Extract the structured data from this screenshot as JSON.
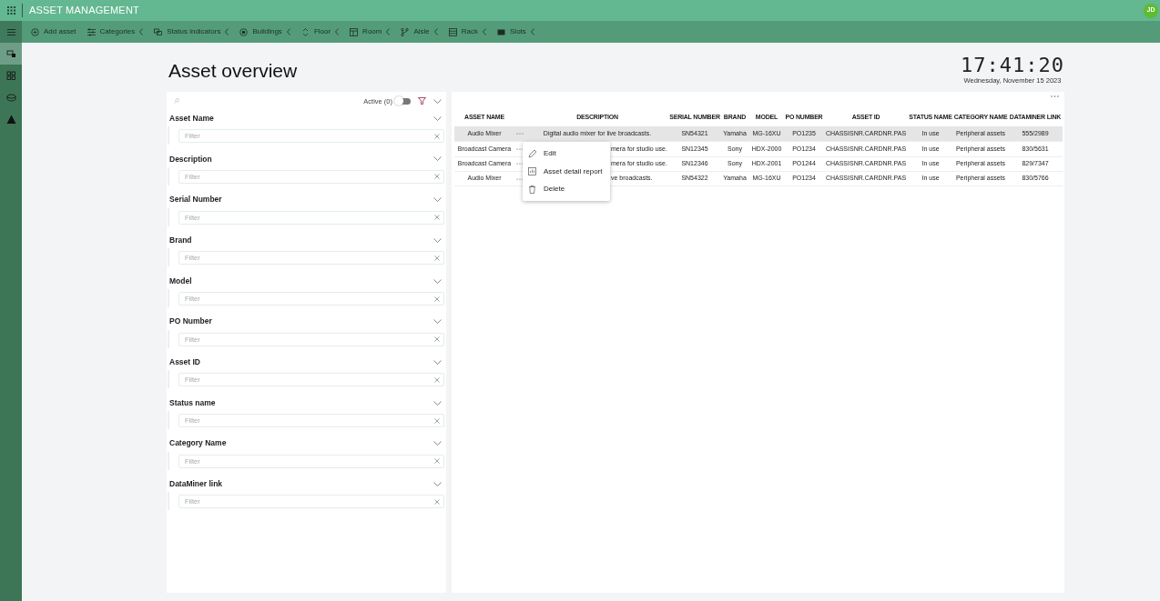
{
  "app": {
    "title": "ASSET MANAGEMENT",
    "user_initials": "JD"
  },
  "toolbar": [
    {
      "label": "Add asset",
      "kind": "add",
      "chevron": false
    },
    {
      "label": "Categories",
      "kind": "categories",
      "chevron": true
    },
    {
      "label": "Status indicators",
      "kind": "status",
      "chevron": true
    },
    {
      "label": "Buildings",
      "kind": "buildings",
      "chevron": true
    },
    {
      "label": "Floor",
      "kind": "floor",
      "chevron": true
    },
    {
      "label": "Room",
      "kind": "room",
      "chevron": true
    },
    {
      "label": "Aisle",
      "kind": "aisle",
      "chevron": true
    },
    {
      "label": "Rack",
      "kind": "rack",
      "chevron": true
    },
    {
      "label": "Slots",
      "kind": "slots",
      "chevron": true
    }
  ],
  "sidebar": {
    "items": [
      {
        "kind": "assets",
        "selected": true
      },
      {
        "kind": "grid",
        "selected": false
      },
      {
        "kind": "disk",
        "selected": false
      },
      {
        "kind": "warning",
        "selected": false
      }
    ]
  },
  "page_title": "Asset overview",
  "clock": {
    "time": "17:41:20",
    "date": "Wednesday, November 15 2023"
  },
  "filters": {
    "active_label": "Active (0)",
    "active_on": false,
    "fields": [
      {
        "label": "Asset Name",
        "placeholder": "Filter"
      },
      {
        "label": "Description",
        "placeholder": "Filter"
      },
      {
        "label": "Serial Number",
        "placeholder": "Filter"
      },
      {
        "label": "Brand",
        "placeholder": "Filter"
      },
      {
        "label": "Model",
        "placeholder": "Filter"
      },
      {
        "label": "PO Number",
        "placeholder": "Filter"
      },
      {
        "label": "Asset ID",
        "placeholder": "Filter"
      },
      {
        "label": "Status name",
        "placeholder": "Filter"
      },
      {
        "label": "Category Name",
        "placeholder": "Filter"
      },
      {
        "label": "DataMiner link",
        "placeholder": "Filter"
      }
    ]
  },
  "table": {
    "columns": [
      "ASSET NAME",
      "DESCRIPTION",
      "SERIAL NUMBER",
      "BRAND",
      "MODEL",
      "PO NUMBER",
      "ASSET ID",
      "STATUS NAME",
      "CATEGORY NAME",
      "DATAMINER LINK"
    ],
    "rows": [
      {
        "selected": true,
        "cells": [
          "Audio Mixer",
          "Digital audio mixer for live broadcasts.",
          "SN54321",
          "Yamaha",
          "MG-16XU",
          "PO1235",
          "CHASSISNR.CARDNR.PAS",
          "In use",
          "Peripheral assets",
          "555/2989"
        ]
      },
      {
        "selected": false,
        "covered": true,
        "cells": [
          "Broadcast Camera",
          "mera for studio use.",
          "SN12345",
          "Sony",
          "HDX-2000",
          "PO1234",
          "CHASSISNR.CARDNR.PAS",
          "In use",
          "Peripheral assets",
          "830/5631"
        ]
      },
      {
        "selected": false,
        "covered": true,
        "cells": [
          "Broadcast Camera",
          "mera for studio use.",
          "SN12346",
          "Sony",
          "HDX-2001",
          "PO1244",
          "CHASSISNR.CARDNR.PAS",
          "In use",
          "Peripheral assets",
          "829/7347"
        ]
      },
      {
        "selected": false,
        "covered": true,
        "cells": [
          "Audio Mixer",
          "ve broadcasts.",
          "SN54322",
          "Yamaha",
          "MG-16XU",
          "PO1234",
          "CHASSISNR.CARDNR.PAS",
          "In use",
          "Peripheral assets",
          "830/5766"
        ]
      }
    ]
  },
  "context_menu": {
    "items": [
      {
        "label": "Edit",
        "kind": "edit"
      },
      {
        "label": "Asset detail report",
        "kind": "report"
      },
      {
        "label": "Delete",
        "kind": "delete"
      }
    ]
  }
}
